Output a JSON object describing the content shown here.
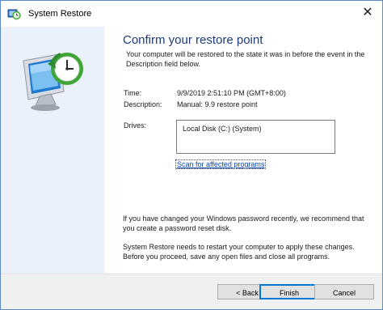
{
  "window": {
    "title": "System Restore",
    "close_glyph": "✕"
  },
  "page": {
    "heading": "Confirm your restore point",
    "intro": "Your computer will be restored to the state it was in before the event in the Description field below."
  },
  "details": {
    "time_label": "Time:",
    "time_value": "9/9/2019 2:51:10 PM (GMT+8:00)",
    "description_label": "Description:",
    "description_value": "Manual: 9.9 restore point",
    "drives_label": "Drives:",
    "drives": [
      "Local Disk (C:) (System)"
    ]
  },
  "scan_link": "Scan for affected programs",
  "notes": {
    "password": "If you have changed your Windows password recently, we recommend that you create a password reset disk.",
    "restart": "System Restore needs to restart your computer to apply these changes. Before you proceed, save any open files and close all programs."
  },
  "buttons": {
    "back": "< Back",
    "finish": "Finish",
    "cancel": "Cancel"
  },
  "icons": {
    "title_icon": "system-restore-icon",
    "sidebar_art": "system-restore-illustration",
    "close": "close-icon"
  },
  "colors": {
    "heading": "#1c3b7b",
    "link": "#0645ad",
    "sidebar_bg": "#eaf1fa",
    "accent": "#0078d7",
    "clock_green": "#3fa535"
  }
}
